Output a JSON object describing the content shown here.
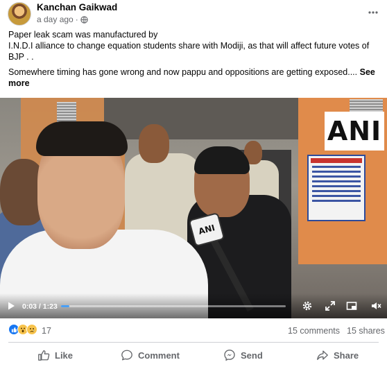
{
  "post": {
    "author": "Kanchan Gaikwad",
    "timestamp": "a day ago",
    "separator": "·",
    "caption_line1": "Paper leak scam was manufactured by",
    "caption_line2": "I.N.D.I alliance to change equation students share with Modiji, as that will affect future votes of BJP . .",
    "caption_line3": "Somewhere timing has gone wrong and now pappu and oppositions  are getting exposed....",
    "see_more": "See more"
  },
  "video": {
    "watermark": "ANI",
    "mic_label": "ANI",
    "current_time": "0:03",
    "duration": "1:23",
    "time_display": "0:03 / 1:23",
    "progress_fraction": 0.036
  },
  "stats": {
    "reaction_count": "17",
    "comments": "15 comments",
    "shares": "15 shares",
    "reactions": [
      "like",
      "wow",
      "sad"
    ]
  },
  "actions": {
    "like": "Like",
    "comment": "Comment",
    "send": "Send",
    "share": "Share"
  },
  "colors": {
    "text_primary": "#050505",
    "text_secondary": "#65676b",
    "accent": "#1877f2",
    "progress": "#4a9ff5"
  }
}
